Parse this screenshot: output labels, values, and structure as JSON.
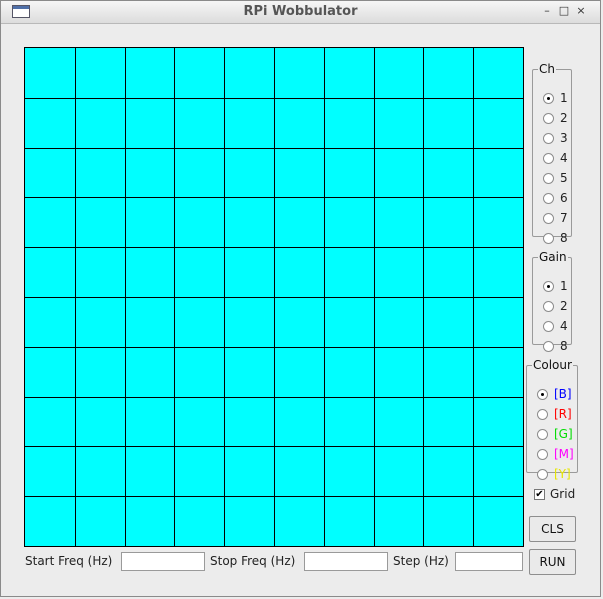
{
  "window": {
    "title": "RPi Wobbulator",
    "controls": {
      "minimize": "–",
      "maximize": "□",
      "close": "×"
    }
  },
  "plot": {
    "background": "#00ffff",
    "grid_divisions": {
      "x": 10,
      "y": 10
    },
    "grid_color": "#000000"
  },
  "channel": {
    "legend": "Ch",
    "options": [
      "1",
      "2",
      "3",
      "4",
      "5",
      "6",
      "7",
      "8"
    ],
    "selected": "1"
  },
  "gain": {
    "legend": "Gain",
    "options": [
      "1",
      "2",
      "4",
      "8"
    ],
    "selected": "1"
  },
  "colour": {
    "legend": "Colour",
    "options": [
      {
        "label": "[B]",
        "color": "#0000ff"
      },
      {
        "label": "[R]",
        "color": "#ff0000"
      },
      {
        "label": "[G]",
        "color": "#00dd00"
      },
      {
        "label": "[M]",
        "color": "#ff00ff"
      },
      {
        "label": "[Y]",
        "color": "#e6e600"
      }
    ],
    "selected": "[B]"
  },
  "grid_toggle": {
    "label": "Grid",
    "checked": true
  },
  "buttons": {
    "cls": "CLS",
    "run": "RUN"
  },
  "freq": {
    "start_label": "Start Freq (Hz)",
    "start_value": "",
    "stop_label": "Stop Freq (Hz)",
    "stop_value": "",
    "step_label": "Step (Hz)",
    "step_value": ""
  }
}
